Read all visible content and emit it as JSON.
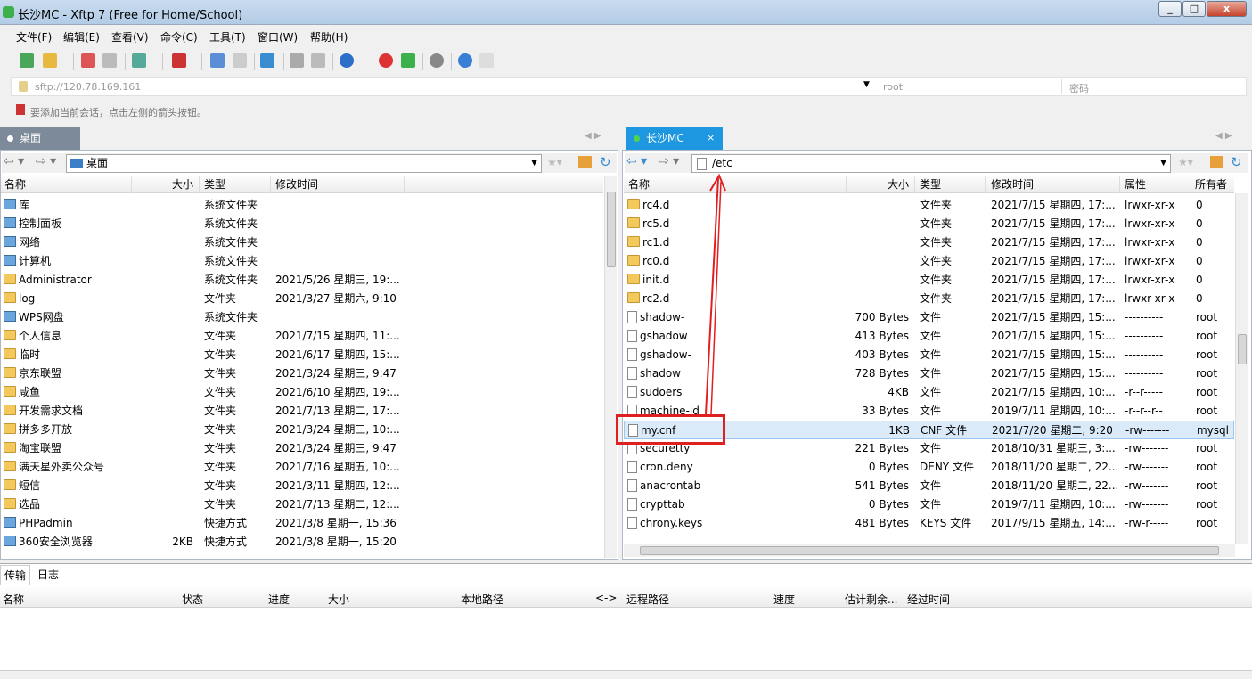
{
  "window": {
    "title": "长沙MC - Xftp 7 (Free for Home/School)",
    "min": "_",
    "max": "□",
    "close": "x"
  },
  "menu": [
    "文件(F)",
    "编辑(E)",
    "查看(V)",
    "命令(C)",
    "工具(T)",
    "窗口(W)",
    "帮助(H)"
  ],
  "address": {
    "url": "sftp://120.78.169.161",
    "user_placeholder": "root",
    "pass_placeholder": "密码"
  },
  "hint": "要添加当前会话，点击左侧的箭头按钮。",
  "left": {
    "tab": "桌面",
    "path": "桌面",
    "columns": [
      "名称",
      "大小",
      "类型",
      "修改时间"
    ],
    "rows": [
      {
        "name": "库",
        "size": "",
        "type": "系统文件夹",
        "mtime": "",
        "icon": "library-icon"
      },
      {
        "name": "控制面板",
        "size": "",
        "type": "系统文件夹",
        "mtime": "",
        "icon": "control-panel-icon"
      },
      {
        "name": "网络",
        "size": "",
        "type": "系统文件夹",
        "mtime": "",
        "icon": "network-icon"
      },
      {
        "name": "计算机",
        "size": "",
        "type": "系统文件夹",
        "mtime": "",
        "icon": "computer-icon"
      },
      {
        "name": "Administrator",
        "size": "",
        "type": "系统文件夹",
        "mtime": "2021/5/26 星期三, 19:...",
        "icon": "user-folder-icon"
      },
      {
        "name": "log",
        "size": "",
        "type": "文件夹",
        "mtime": "2021/3/27 星期六, 9:10",
        "icon": "folder-icon"
      },
      {
        "name": "WPS网盘",
        "size": "",
        "type": "系统文件夹",
        "mtime": "",
        "icon": "cloud-icon"
      },
      {
        "name": "个人信息",
        "size": "",
        "type": "文件夹",
        "mtime": "2021/7/15 星期四, 11:...",
        "icon": "folder-icon"
      },
      {
        "name": "临时",
        "size": "",
        "type": "文件夹",
        "mtime": "2021/6/17 星期四, 15:...",
        "icon": "folder-icon"
      },
      {
        "name": "京东联盟",
        "size": "",
        "type": "文件夹",
        "mtime": "2021/3/24 星期三, 9:47",
        "icon": "folder-icon"
      },
      {
        "name": "咸鱼",
        "size": "",
        "type": "文件夹",
        "mtime": "2021/6/10 星期四, 19:...",
        "icon": "folder-icon"
      },
      {
        "name": "开发需求文档",
        "size": "",
        "type": "文件夹",
        "mtime": "2021/7/13 星期二, 17:...",
        "icon": "folder-icon"
      },
      {
        "name": "拼多多开放",
        "size": "",
        "type": "文件夹",
        "mtime": "2021/3/24 星期三, 10:...",
        "icon": "folder-icon"
      },
      {
        "name": "淘宝联盟",
        "size": "",
        "type": "文件夹",
        "mtime": "2021/3/24 星期三, 9:47",
        "icon": "folder-icon"
      },
      {
        "name": "满天星外卖公众号",
        "size": "",
        "type": "文件夹",
        "mtime": "2021/7/16 星期五, 10:...",
        "icon": "folder-icon"
      },
      {
        "name": "短信",
        "size": "",
        "type": "文件夹",
        "mtime": "2021/3/11 星期四, 12:...",
        "icon": "folder-icon"
      },
      {
        "name": "选品",
        "size": "",
        "type": "文件夹",
        "mtime": "2021/7/13 星期二, 12:...",
        "icon": "folder-icon"
      },
      {
        "name": "PHPadmin",
        "size": "",
        "type": "快捷方式",
        "mtime": "2021/3/8 星期一, 15:36",
        "icon": "shortcut-icon"
      },
      {
        "name": "360安全浏览器",
        "size": "2KB",
        "type": "快捷方式",
        "mtime": "2021/3/8 星期一, 15:20",
        "icon": "shortcut-icon"
      }
    ]
  },
  "right": {
    "tab": "长沙MC",
    "path": "/etc",
    "columns": [
      "名称",
      "大小",
      "类型",
      "修改时间",
      "属性",
      "所有者"
    ],
    "rows": [
      {
        "name": "rc4.d",
        "size": "",
        "type": "文件夹",
        "mtime": "2021/7/15 星期四, 17:...",
        "attr": "lrwxr-xr-x",
        "owner": "0",
        "icon": "folder-link-icon"
      },
      {
        "name": "rc5.d",
        "size": "",
        "type": "文件夹",
        "mtime": "2021/7/15 星期四, 17:...",
        "attr": "lrwxr-xr-x",
        "owner": "0",
        "icon": "folder-link-icon"
      },
      {
        "name": "rc1.d",
        "size": "",
        "type": "文件夹",
        "mtime": "2021/7/15 星期四, 17:...",
        "attr": "lrwxr-xr-x",
        "owner": "0",
        "icon": "folder-link-icon"
      },
      {
        "name": "rc0.d",
        "size": "",
        "type": "文件夹",
        "mtime": "2021/7/15 星期四, 17:...",
        "attr": "lrwxr-xr-x",
        "owner": "0",
        "icon": "folder-link-icon"
      },
      {
        "name": "init.d",
        "size": "",
        "type": "文件夹",
        "mtime": "2021/7/15 星期四, 17:...",
        "attr": "lrwxr-xr-x",
        "owner": "0",
        "icon": "folder-link-icon"
      },
      {
        "name": "rc2.d",
        "size": "",
        "type": "文件夹",
        "mtime": "2021/7/15 星期四, 17:...",
        "attr": "lrwxr-xr-x",
        "owner": "0",
        "icon": "folder-link-icon"
      },
      {
        "name": "shadow-",
        "size": "700 Bytes",
        "type": "文件",
        "mtime": "2021/7/15 星期四, 15:...",
        "attr": "----------",
        "owner": "root",
        "icon": "file-icon"
      },
      {
        "name": "gshadow",
        "size": "413 Bytes",
        "type": "文件",
        "mtime": "2021/7/15 星期四, 15:...",
        "attr": "----------",
        "owner": "root",
        "icon": "file-icon"
      },
      {
        "name": "gshadow-",
        "size": "403 Bytes",
        "type": "文件",
        "mtime": "2021/7/15 星期四, 15:...",
        "attr": "----------",
        "owner": "root",
        "icon": "file-icon"
      },
      {
        "name": "shadow",
        "size": "728 Bytes",
        "type": "文件",
        "mtime": "2021/7/15 星期四, 15:...",
        "attr": "----------",
        "owner": "root",
        "icon": "file-icon"
      },
      {
        "name": "sudoers",
        "size": "4KB",
        "type": "文件",
        "mtime": "2021/7/15 星期四, 10:...",
        "attr": "-r--r-----",
        "owner": "root",
        "icon": "file-icon"
      },
      {
        "name": "machine-id",
        "size": "33 Bytes",
        "type": "文件",
        "mtime": "2019/7/11 星期四, 10:...",
        "attr": "-r--r--r--",
        "owner": "root",
        "icon": "file-icon"
      },
      {
        "name": "my.cnf",
        "size": "1KB",
        "type": "CNF 文件",
        "mtime": "2021/7/20 星期二, 9:20",
        "attr": "-rw-------",
        "owner": "mysql",
        "icon": "file-icon"
      },
      {
        "name": "securetty",
        "size": "221 Bytes",
        "type": "文件",
        "mtime": "2018/10/31 星期三, 3:...",
        "attr": "-rw-------",
        "owner": "root",
        "icon": "file-icon"
      },
      {
        "name": "cron.deny",
        "size": "0 Bytes",
        "type": "DENY 文件",
        "mtime": "2018/11/20 星期二, 22...",
        "attr": "-rw-------",
        "owner": "root",
        "icon": "file-icon"
      },
      {
        "name": "anacrontab",
        "size": "541 Bytes",
        "type": "文件",
        "mtime": "2018/11/20 星期二, 22...",
        "attr": "-rw-------",
        "owner": "root",
        "icon": "file-icon"
      },
      {
        "name": "crypttab",
        "size": "0 Bytes",
        "type": "文件",
        "mtime": "2019/7/11 星期四, 10:...",
        "attr": "-rw-------",
        "owner": "root",
        "icon": "file-icon"
      },
      {
        "name": "chrony.keys",
        "size": "481 Bytes",
        "type": "KEYS 文件",
        "mtime": "2017/9/15 星期五, 14:...",
        "attr": "-rw-r-----",
        "owner": "root",
        "icon": "file-icon"
      }
    ],
    "selected": "my.cnf"
  },
  "bottom": {
    "tabs": [
      "传输",
      "日志"
    ],
    "columns": [
      "名称",
      "状态",
      "进度",
      "大小",
      "本地路径",
      "<->",
      "远程路径",
      "速度",
      "估计剩余...",
      "经过时间"
    ]
  },
  "colors": {
    "accent": "#1d97e0",
    "annotation": "#e02020",
    "selected_row": "#dbeaf9"
  }
}
